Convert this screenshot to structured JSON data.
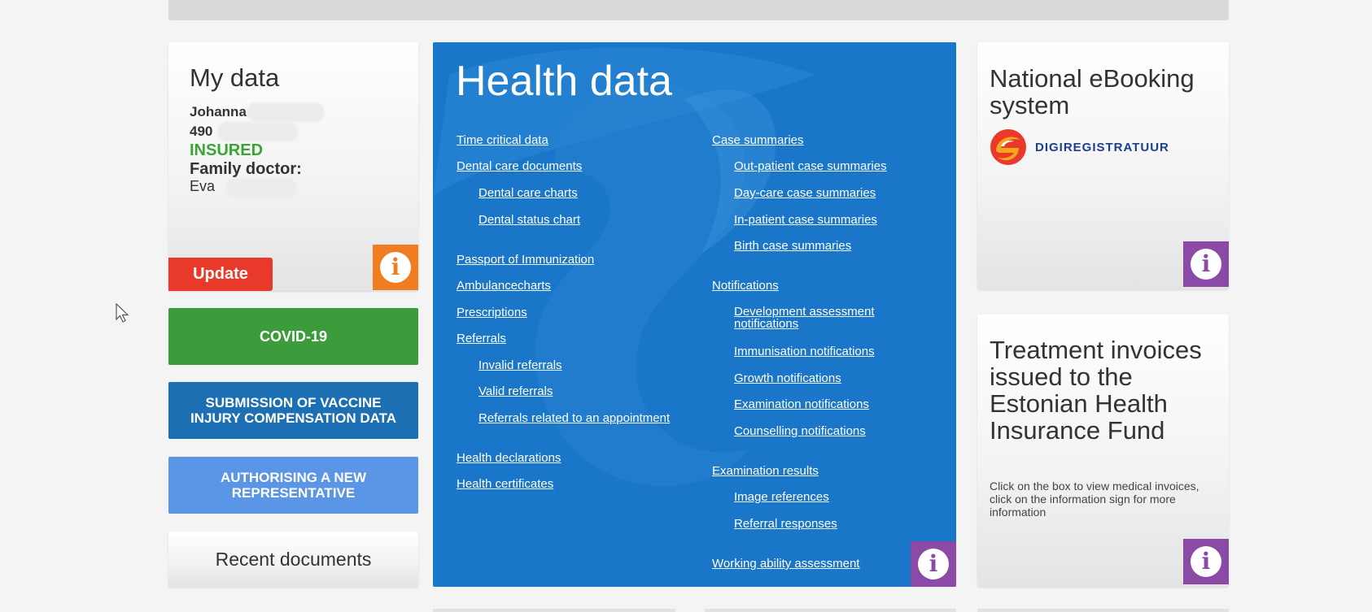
{
  "my_data": {
    "title": "My data",
    "name_prefix": "Johanna",
    "id_prefix": "490",
    "insurance_status": "INSURED",
    "family_doctor_label": "Family doctor:",
    "doctor_prefix": "Eva",
    "update_label": "Update"
  },
  "buttons": {
    "covid": "COVID-19",
    "vaccine_line1": "SUBMISSION OF VACCINE",
    "vaccine_line2": "INJURY COMPENSATION DATA",
    "authorising_line1": "AUTHORISING A NEW",
    "authorising_line2": "REPRESENTATIVE",
    "recent_documents": "Recent documents"
  },
  "health_data": {
    "title": "Health data",
    "left_links": [
      "Time critical data",
      "Dental care documents",
      "Dental care charts",
      "Dental status chart",
      "Passport of Immunization",
      "Ambulancecharts",
      "Prescriptions",
      "Referrals",
      "Invalid referrals",
      "Valid referrals",
      "Referrals related to an appointment",
      "Health declarations",
      "Health certificates"
    ],
    "right_links": [
      "Case summaries",
      "Out-patient case summaries",
      "Day-care case summaries",
      "In-patient case summaries",
      "Birth case summaries",
      "Notifications",
      "Development assessment notifications",
      "Immunisation notifications",
      "Growth notifications",
      "Examination notifications",
      "Counselling notifications",
      "Examination results",
      "Image references",
      "Referral responses",
      "Working ability assessment"
    ]
  },
  "ebooking": {
    "title": "National eBooking system",
    "logo_text": "DIGIREGISTRATUUR"
  },
  "invoices": {
    "title": "Treatment invoices issued to the Estonian Health Insurance Fund",
    "description": "Click on the box to view medical invoices, click on the information sign for more information"
  },
  "icons": {
    "info": "info-icon",
    "cursor": "mouse-pointer-icon"
  },
  "colors": {
    "update_red": "#e8392a",
    "info_orange": "#f07d22",
    "info_purple": "#8a4aa5",
    "covid_green": "#3c9b3a",
    "vaccine_blue": "#1c6fb3",
    "authorising_blue": "#5b95e5",
    "health_blue": "#1976c9",
    "insured_green": "#3aa535"
  }
}
